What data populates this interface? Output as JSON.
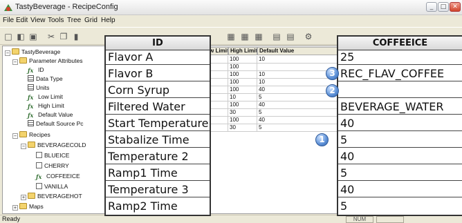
{
  "window": {
    "title": "TastyBeverage - RecipeConfig",
    "min": "_",
    "max": "□",
    "close": "✕"
  },
  "menu": [
    "File",
    "Edit",
    "View",
    "Tools",
    "Tree",
    "Grid",
    "Help"
  ],
  "toolbar_icons": [
    "new-doc",
    "open-folder",
    "save",
    "cut",
    "copy",
    "paste",
    "grid-a",
    "grid-b",
    "grid-c",
    "grid-d",
    "grid-e",
    "grid-f"
  ],
  "tree": [
    {
      "label": "TastyBeverage",
      "icon": "folder",
      "exp": "−"
    },
    {
      "label": "Parameter Attributes",
      "icon": "folder",
      "exp": "−"
    },
    {
      "label": "ID",
      "icon": "fx"
    },
    {
      "label": "Data Type",
      "icon": "grid"
    },
    {
      "label": "Units",
      "icon": "grid"
    },
    {
      "label": "Low Limit",
      "icon": "fx"
    },
    {
      "label": "High Limit",
      "icon": "fx"
    },
    {
      "label": "Default Value",
      "icon": "fx"
    },
    {
      "label": "Default Source Pc",
      "icon": "grid"
    },
    {
      "label": "Recipes",
      "icon": "folder",
      "exp": "−"
    },
    {
      "label": "BEVERAGECOLD",
      "icon": "folder",
      "exp": "−"
    },
    {
      "label": "BLUEICE",
      "icon": "doc"
    },
    {
      "label": "CHERRY",
      "icon": "doc"
    },
    {
      "label": "COFFEEICE",
      "icon": "fx"
    },
    {
      "label": "VANILLA",
      "icon": "doc"
    },
    {
      "label": "BEVERAGEHOT",
      "icon": "folder",
      "exp": "+"
    },
    {
      "label": "Maps",
      "icon": "folder",
      "exp": "+"
    }
  ],
  "grid": {
    "headers": [
      "w Limit",
      "High Limit",
      "Default Value"
    ],
    "rows": [
      [
        "",
        "100",
        "10"
      ],
      [
        "",
        "100",
        ""
      ],
      [
        "",
        "100",
        "10"
      ],
      [
        "",
        "100",
        "10"
      ],
      [
        "",
        "100",
        "40"
      ],
      [
        "",
        "10",
        "5"
      ],
      [
        "",
        "100",
        "40"
      ],
      [
        "",
        "30",
        "5"
      ],
      [
        "",
        "100",
        "40"
      ],
      [
        "",
        "30",
        "5"
      ]
    ]
  },
  "status": {
    "text": "Ready",
    "panel": "NUM"
  },
  "callout_left": {
    "header": "ID",
    "rows": [
      "Flavor A",
      "Flavor B",
      "Corn Syrup",
      "Filtered Water",
      "Start Temperature",
      "Stabalize Time",
      "Temperature 2",
      "Ramp1 Time",
      "Temperature 3",
      "Ramp2 Time"
    ]
  },
  "callout_right": {
    "header": "COFFEEICE",
    "rows": [
      "25",
      "REC_FLAV_COFFEE",
      "",
      "BEVERAGE_WATER",
      "40",
      "5",
      "40",
      "5",
      "40",
      "5"
    ]
  },
  "badges": [
    "3",
    "2",
    "1"
  ]
}
